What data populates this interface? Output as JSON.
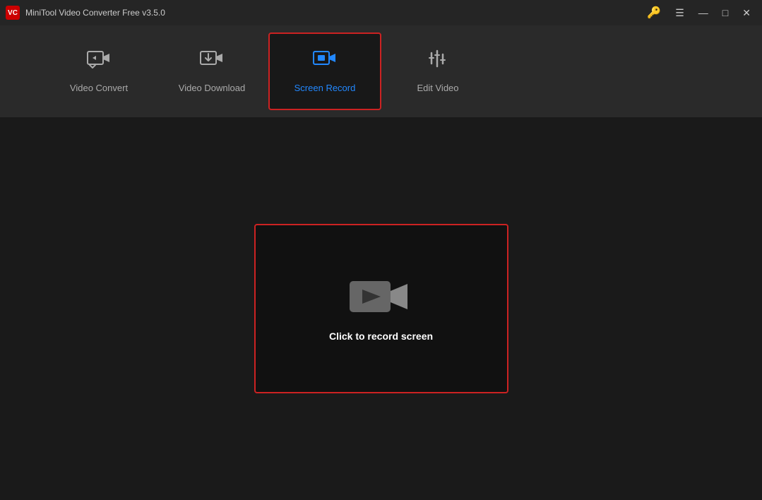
{
  "app": {
    "title": "MiniTool Video Converter Free v3.5.0",
    "logo_text": "VC"
  },
  "titlebar": {
    "key_icon": "🔑",
    "menu_icon": "☰",
    "minimize_icon": "—",
    "maximize_icon": "□",
    "close_icon": "✕"
  },
  "nav": {
    "tabs": [
      {
        "id": "video-convert",
        "label": "Video Convert",
        "active": false
      },
      {
        "id": "video-download",
        "label": "Video Download",
        "active": false
      },
      {
        "id": "screen-record",
        "label": "Screen Record",
        "active": true
      },
      {
        "id": "edit-video",
        "label": "Edit Video",
        "active": false
      }
    ]
  },
  "main": {
    "record_label": "Click to record screen"
  },
  "colors": {
    "accent_red": "#cc2222",
    "accent_blue": "#2288ff",
    "active_tab_border": "#cc2222",
    "bg_dark": "#1a1a1a",
    "bg_nav": "#2a2a2a",
    "bg_titlebar": "#252525",
    "text_inactive": "#aaaaaa",
    "text_active": "#2288ff",
    "text_white": "#ffffff"
  }
}
